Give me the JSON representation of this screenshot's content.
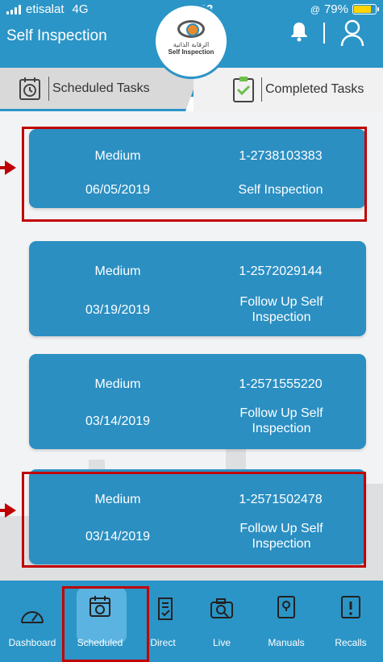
{
  "status_bar": {
    "carrier": "etisalat",
    "network": "4G",
    "time": "10:03",
    "battery": "79%"
  },
  "header": {
    "title": "Self Inspection",
    "logo_arabic": "الرقابة الذاتية",
    "logo_english": "Self Inspection"
  },
  "tabs": {
    "scheduled": "Scheduled Tasks",
    "completed": "Completed Tasks"
  },
  "tasks": [
    {
      "priority": "Medium",
      "id": "1-2738103383",
      "date": "06/05/2019",
      "type": "Self Inspection"
    },
    {
      "priority": "Medium",
      "id": "1-2572029144",
      "date": "03/19/2019",
      "type": "Follow Up Self Inspection"
    },
    {
      "priority": "Medium",
      "id": "1-2571555220",
      "date": "03/14/2019",
      "type": "Follow Up Self Inspection"
    },
    {
      "priority": "Medium",
      "id": "1-2571502478",
      "date": "03/14/2019",
      "type": "Follow Up Self Inspection"
    }
  ],
  "nav": {
    "dashboard": "Dashboard",
    "scheduled": "Scheduled",
    "direct": "Direct",
    "live": "Live",
    "manuals": "Manuals",
    "recalls": "Recalls"
  },
  "colors": {
    "primary": "#2b95c7",
    "card": "#2b8fc2",
    "highlight": "#c00000",
    "active_nav": "#5ab3e0"
  }
}
